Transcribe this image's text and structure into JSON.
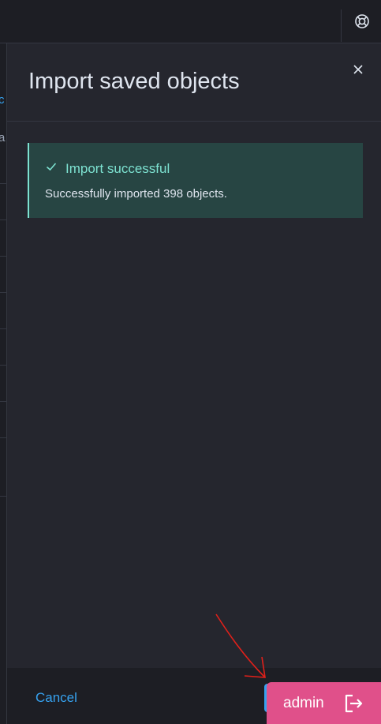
{
  "header": {
    "help_icon": "help-lifebuoy-icon"
  },
  "background_page": {
    "fragment_1": "c",
    "fragment_2": "a"
  },
  "flyout": {
    "title": "Import saved objects",
    "close_icon": "close-icon",
    "callout": {
      "title": "Import successful",
      "body": "Successfully imported 398 objects.",
      "icon": "check-icon",
      "color": "#7de2d1",
      "background": "#274543"
    },
    "footer": {
      "cancel_label": "Cancel",
      "primary_button_color": "#36a2ef"
    }
  },
  "user_badge": {
    "label": "admin",
    "icon": "logout-icon",
    "color": "#e0508a"
  },
  "annotation": {
    "arrow_color": "#e0201a"
  }
}
